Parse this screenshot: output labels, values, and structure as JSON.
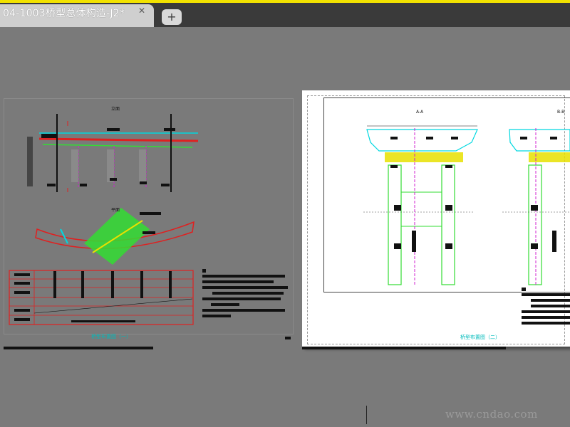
{
  "tab": {
    "title": "04-1003桥型总体构造-J2*",
    "close_glyph": "✕",
    "add_glyph": "+"
  },
  "drawings": {
    "left_title_top": "立面",
    "left_title_plan": "平面",
    "left_caption": "桥型布置图（一）",
    "right_section_a": "A-A",
    "right_section_b": "B-B",
    "right_caption": "桥型布置图（二）"
  },
  "watermark": "www.cndao.com",
  "colors": {
    "accent": "#f2e200",
    "cyan": "#00d8e0",
    "green": "#33dd33",
    "red": "#e02020",
    "magenta": "#d020d0",
    "yellow": "#e8e000"
  }
}
